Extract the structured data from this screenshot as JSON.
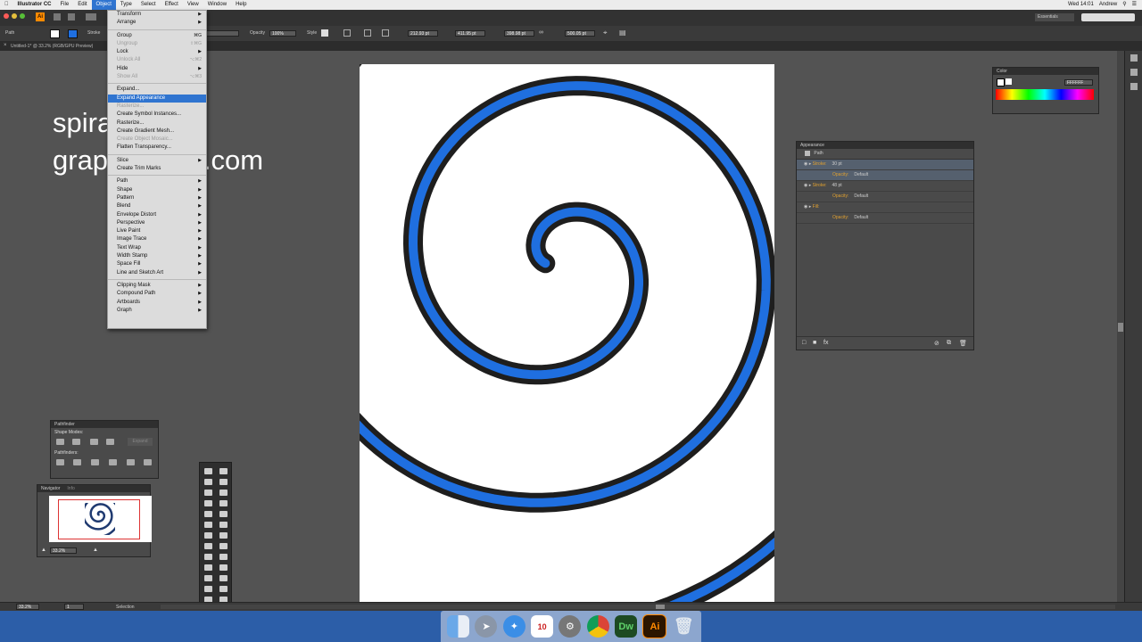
{
  "menubar": {
    "app_name": "Illustrator CC",
    "items": [
      "File",
      "Edit",
      "Object",
      "Type",
      "Select",
      "Effect",
      "View",
      "Window",
      "Help"
    ],
    "active_item": "Object",
    "right_user": "Andrew",
    "right_time": "Wed 14:01"
  },
  "workspace_label": "Essentials",
  "control_bar": {
    "selection_label": "Path",
    "stroke_label": "Stroke",
    "style_label": "Style",
    "opacity_label": "Opacity",
    "opacity_value": "100%",
    "x_value": "212.93 pt",
    "y_value": "411.95 pt",
    "w_value": "398.98 pt",
    "h_value": "500.05 pt"
  },
  "document_tab": "Untitled-1* @ 33.2% (RGB/GPU Preview)",
  "overlay_text": {
    "line1": "spiral",
    "line2": "graphicxtras.com"
  },
  "object_menu": [
    {
      "label": "Transform",
      "sub": true
    },
    {
      "label": "Arrange",
      "sub": true
    },
    {
      "sep": true
    },
    {
      "label": "Group",
      "shortcut": "⌘G"
    },
    {
      "label": "Ungroup",
      "dis": true,
      "shortcut": "⇧⌘G"
    },
    {
      "label": "Lock",
      "sub": true
    },
    {
      "label": "Unlock All",
      "dis": true,
      "shortcut": "⌥⌘2"
    },
    {
      "label": "Hide",
      "sub": true
    },
    {
      "label": "Show All",
      "dis": true,
      "shortcut": "⌥⌘3"
    },
    {
      "sep": true
    },
    {
      "label": "Expand...",
      "dis": false
    },
    {
      "label": "Expand Appearance",
      "sel": true
    },
    {
      "label": "Rasterize...",
      "dis": true
    },
    {
      "label": "Create Symbol Instances..."
    },
    {
      "label": "Rasterize..."
    },
    {
      "label": "Create Gradient Mesh..."
    },
    {
      "label": "Create Object Mosaic...",
      "dis": true
    },
    {
      "label": "Flatten Transparency..."
    },
    {
      "sep": true
    },
    {
      "label": "Slice",
      "sub": true
    },
    {
      "label": "Create Trim Marks"
    },
    {
      "sep": true
    },
    {
      "label": "Path",
      "sub": true
    },
    {
      "label": "Shape",
      "sub": true
    },
    {
      "label": "Pattern",
      "sub": true
    },
    {
      "label": "Blend",
      "sub": true
    },
    {
      "label": "Envelope Distort",
      "sub": true
    },
    {
      "label": "Perspective",
      "sub": true
    },
    {
      "label": "Live Paint",
      "sub": true
    },
    {
      "label": "Image Trace",
      "sub": true
    },
    {
      "label": "Text Wrap",
      "sub": true
    },
    {
      "label": "Width Stamp",
      "sub": true
    },
    {
      "label": "Space Fill",
      "sub": true
    },
    {
      "label": "Line and Sketch Art",
      "sub": true
    },
    {
      "sep": true
    },
    {
      "label": "Clipping Mask",
      "sub": true
    },
    {
      "label": "Compound Path",
      "sub": true
    },
    {
      "label": "Artboards",
      "sub": true
    },
    {
      "label": "Graph",
      "sub": true
    }
  ],
  "color_panel": {
    "title": "Color",
    "hex_value": "FFFFFF"
  },
  "appearance_panel": {
    "title": "Appearance",
    "object_label": "Path",
    "rows": [
      {
        "label": "Stroke:",
        "value": "30 pt"
      },
      {
        "label": "Opacity:",
        "value": "Default"
      },
      {
        "label": "Stroke:",
        "value": "48 pt"
      },
      {
        "label": "Opacity:",
        "value": "Default"
      },
      {
        "label": "Fill:",
        "value": ""
      },
      {
        "label": "Opacity:",
        "value": "Default"
      }
    ]
  },
  "pathfinder_panel": {
    "title": "Pathfinder",
    "shape_modes_label": "Shape Modes:",
    "pathfinders_label": "Pathfinders:",
    "expand_label": "Expand"
  },
  "navigator_panel": {
    "tab1": "Navigator",
    "tab2": "Info",
    "zoom_value": "33.2%"
  },
  "status_bar": {
    "zoom": "33.2%",
    "page": "1",
    "tool": "Selection"
  },
  "dock": {
    "items": [
      "finder-icon",
      "launchpad-icon",
      "safari-icon",
      "calendar-icon",
      "system-preferences-icon",
      "chrome-icon",
      "Dw",
      "Ai",
      "trash-icon"
    ],
    "calendar_day": "10",
    "dw_label": "Dw",
    "ai_label": "Ai"
  },
  "colors": {
    "spiral_outer": "#1e1e1e",
    "spiral_inner": "#1f6fe0",
    "ai_orange": "#ff8a00",
    "dw_green": "#2a8c33"
  }
}
